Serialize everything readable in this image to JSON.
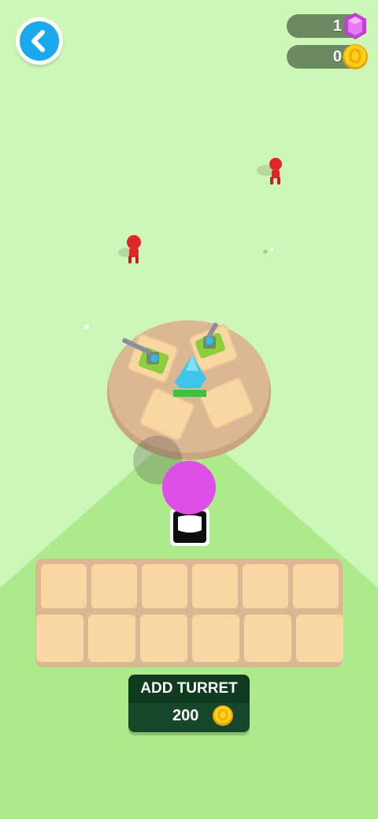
{
  "hud": {
    "gems": "1",
    "coins": "0",
    "gem_icon": "gem-icon",
    "coin_icon": "coin-icon",
    "back_icon": "chevron-left-icon"
  },
  "add_turret": {
    "label": "ADD TURRET",
    "price": "200"
  },
  "colors": {
    "background": "#cdf7b8",
    "lane": "#acea8c",
    "platform": "#dbb893",
    "tile": "#f9d7a2",
    "enemy": "#e02626",
    "player": "#dd4fe7",
    "button": "#17472a",
    "back_button": "#1aa9ef"
  }
}
